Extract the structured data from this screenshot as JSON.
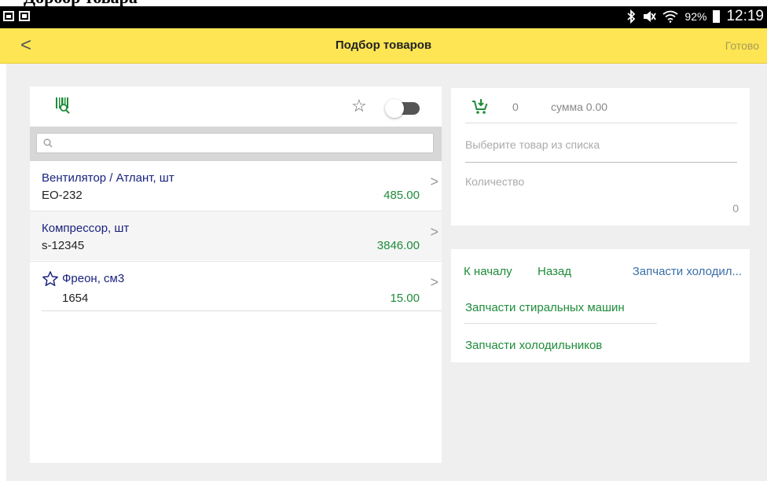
{
  "caption": "Дорбор товара",
  "status_bar": {
    "battery_percent": "92%",
    "time": "12:19",
    "icons": [
      "gallery-icon",
      "message-icon",
      "bluetooth-icon",
      "mute-icon",
      "wifi-icon",
      "battery-icon"
    ]
  },
  "app_bar": {
    "back_glyph": "<",
    "title": "Подбор товаров",
    "done_label": "Готово"
  },
  "search": {
    "placeholder": ""
  },
  "items": [
    {
      "name": "Вентилятор / Атлант, шт",
      "code": "EO-232",
      "price": "485.00",
      "favorite": false
    },
    {
      "name": "Компрессор, шт",
      "code": "s-12345",
      "price": "3846.00",
      "favorite": false
    },
    {
      "name": "Фреон, см3",
      "code": "1654",
      "price": "15.00",
      "favorite": true
    }
  ],
  "cart": {
    "count": "0",
    "sum_label": "сумма 0.00",
    "select_hint": "Выберите товар из списка",
    "quantity_label": "Количество",
    "quantity_value": "0"
  },
  "navigation": {
    "start_label": "К началу",
    "back_label": "Назад",
    "current_label": "Запчасти холодил...",
    "categories": [
      "Запчасти стиральных машин",
      "Запчасти холодильников"
    ]
  },
  "colors": {
    "app_bar": "#fde553",
    "item_name": "#1a237e",
    "price": "#1e8c3a",
    "link": "#1e8c3a",
    "background": "#efefef"
  }
}
